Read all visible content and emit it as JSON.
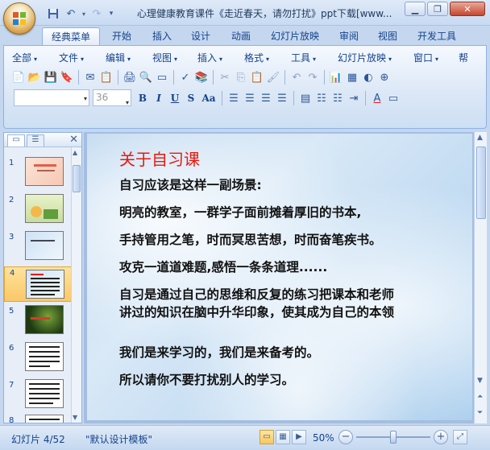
{
  "window": {
    "title": "心理健康教育课件《走近春天，请勿打扰》ppt下载[www...",
    "controls": [
      "minimize",
      "restore",
      "close"
    ]
  },
  "quick_access": [
    {
      "name": "save-icon",
      "glyph": "💾"
    },
    {
      "name": "undo-icon",
      "glyph": "↶"
    },
    {
      "name": "redo-icon",
      "glyph": "↷"
    },
    {
      "name": "customize-icon",
      "glyph": "▾"
    }
  ],
  "tabs": [
    "经典菜单",
    "开始",
    "插入",
    "设计",
    "动画",
    "幻灯片放映",
    "审阅",
    "视图",
    "开发工具"
  ],
  "active_tab": "经典菜单",
  "menus": [
    "全部",
    "文件",
    "编辑",
    "视图",
    "插入",
    "格式",
    "工具",
    "幻灯片放映",
    "窗口",
    "帮"
  ],
  "font": {
    "name": "",
    "size": "36"
  },
  "format_buttons": [
    "B",
    "I",
    "U",
    "S",
    "Aa"
  ],
  "slide_panel": {
    "tabs": [
      "slides",
      "outline"
    ],
    "thumbnails": [
      {
        "num": "1",
        "style": "pink"
      },
      {
        "num": "2",
        "style": "cartoon"
      },
      {
        "num": "3",
        "style": "blue"
      },
      {
        "num": "4",
        "style": "text",
        "selected": true
      },
      {
        "num": "5",
        "style": "dark"
      },
      {
        "num": "6",
        "style": "text"
      },
      {
        "num": "7",
        "style": "text"
      },
      {
        "num": "8",
        "style": "text"
      }
    ]
  },
  "slide": {
    "title": "关于自习课",
    "lines": [
      "自习应该是这样一副场景:",
      "明亮的教室，一群学子面前摊着厚旧的书本,",
      "手持管用之笔，时而冥思苦想，时而奋笔疾书。",
      "攻克一道道难题,感悟一条条道理......",
      "自习是通过自己的思维和反复的练习把课本和老师",
      "讲过的知识在脑中升华印象，使其成为自己的本领",
      "我们是来学习的，我们是来备考的。",
      "所以请你不要打扰别人的学习。"
    ]
  },
  "status": {
    "slide_counter": "幻灯片 4/52",
    "template": "\"默认设计模板\"",
    "zoom": "50%",
    "zoom_level": 0.5
  },
  "colors": {
    "slide_title": "#e8190e",
    "accent": "#15428b",
    "selected_thumb": "#fbc868"
  }
}
